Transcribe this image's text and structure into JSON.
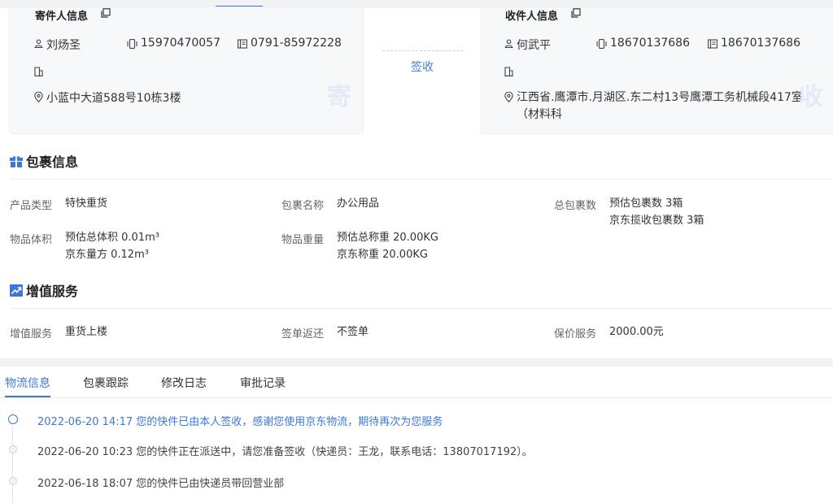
{
  "sender": {
    "title": "寄件人信息",
    "name": "刘炀圣",
    "mobile": "15970470057",
    "phone": "0791-85972228",
    "address": "小蓝中大道588号10栋3楼",
    "stamp": "寄"
  },
  "receiver": {
    "title": "收件人信息",
    "name": "何武平",
    "mobile": "18670137686",
    "phone": "18670137686",
    "address_line1": "江西省.鹰潭市.月湖区.东二村13号鹰潭工务机械段417室",
    "address_line2": "（材料科",
    "stamp": "收"
  },
  "status": {
    "label": "签收"
  },
  "package": {
    "title": "包裹信息",
    "product_type_label": "产品类型",
    "product_type_value": "特快重货",
    "package_name_label": "包裹名称",
    "package_name_value": "办公用品",
    "total_label": "总包裹数",
    "total_estimated": "预估包裹数 3箱",
    "total_collected": "京东揽收包裹数 3箱",
    "volume_label": "物品体积",
    "volume_estimated": "预估总体积 0.01m³",
    "volume_jd": "京东量方 0.12m³",
    "weight_label": "物品重量",
    "weight_estimated": "预估总称重 20.00KG",
    "weight_jd": "京东称重 20.00KG"
  },
  "value_added": {
    "title": "增值服务",
    "service_label": "增值服务",
    "service_value": "重货上楼",
    "return_label": "签单返还",
    "return_value": "不签单",
    "insurance_label": "保价服务",
    "insurance_value": "2000.00元"
  },
  "tabs": [
    {
      "label": "物流信息"
    },
    {
      "label": "包裹跟踪"
    },
    {
      "label": "修改日志"
    },
    {
      "label": "审批记录"
    }
  ],
  "timeline": [
    {
      "text": "2022-06-20 14:17 您的快件已由本人签收，感谢您使用京东物流，期待再次为您服务"
    },
    {
      "text": "2022-06-20 10:23 您的快件正在派送中，请您准备签收（快递员：王龙，联系电话：13807017192）。"
    },
    {
      "text": "2022-06-18 18:07 您的快件已由快递员带回营业部"
    }
  ],
  "colors": {
    "accent": "#3c78d8",
    "card_bg": "#f7f8fa",
    "stamp": "#e3ebf7"
  }
}
